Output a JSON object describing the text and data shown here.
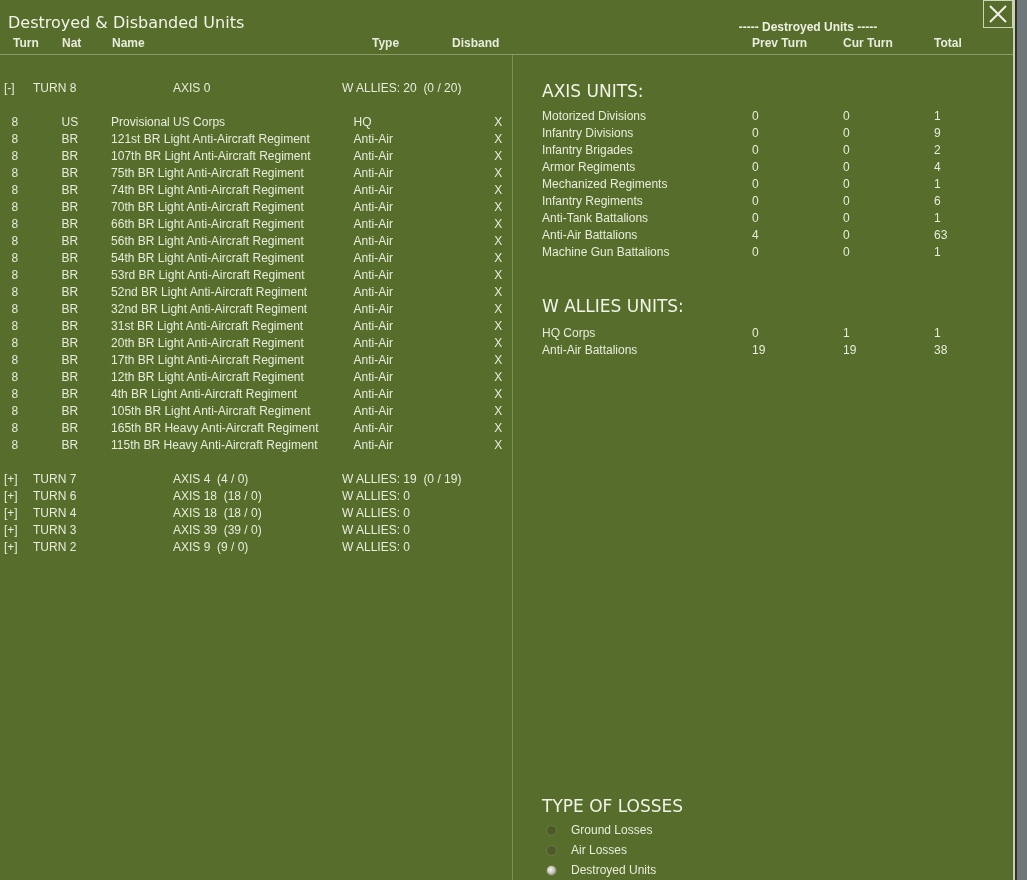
{
  "window": {
    "title": "Destroyed & Disbanded Units"
  },
  "left_columns": [
    "Turn",
    "Nat",
    "Name",
    "Type",
    "Disband"
  ],
  "right_header": {
    "group_label": "----- Destroyed Units -----",
    "columns": [
      "Prev Turn",
      "Cur Turn",
      "Total"
    ]
  },
  "turns": [
    {
      "toggle": "[-]",
      "label": "TURN 8",
      "axis": "AXIS 0",
      "allies": "W ALLIES: 20  (0 / 20)",
      "units": [
        {
          "turn": "8",
          "nat": "US",
          "name": "Provisional US Corps",
          "type": "HQ",
          "disband": "X"
        },
        {
          "turn": "8",
          "nat": "BR",
          "name": "121st BR Light Anti-Aircraft Regiment",
          "type": "Anti-Air",
          "disband": "X"
        },
        {
          "turn": "8",
          "nat": "BR",
          "name": "107th BR Light Anti-Aircraft Regiment",
          "type": "Anti-Air",
          "disband": "X"
        },
        {
          "turn": "8",
          "nat": "BR",
          "name": "75th BR Light Anti-Aircraft Regiment",
          "type": "Anti-Air",
          "disband": "X"
        },
        {
          "turn": "8",
          "nat": "BR",
          "name": "74th BR Light Anti-Aircraft Regiment",
          "type": "Anti-Air",
          "disband": "X"
        },
        {
          "turn": "8",
          "nat": "BR",
          "name": "70th BR Light Anti-Aircraft Regiment",
          "type": "Anti-Air",
          "disband": "X"
        },
        {
          "turn": "8",
          "nat": "BR",
          "name": "66th BR Light Anti-Aircraft Regiment",
          "type": "Anti-Air",
          "disband": "X"
        },
        {
          "turn": "8",
          "nat": "BR",
          "name": "56th BR Light Anti-Aircraft Regiment",
          "type": "Anti-Air",
          "disband": "X"
        },
        {
          "turn": "8",
          "nat": "BR",
          "name": "54th BR Light Anti-Aircraft Regiment",
          "type": "Anti-Air",
          "disband": "X"
        },
        {
          "turn": "8",
          "nat": "BR",
          "name": "53rd BR Light Anti-Aircraft Regiment",
          "type": "Anti-Air",
          "disband": "X"
        },
        {
          "turn": "8",
          "nat": "BR",
          "name": "52nd BR Light Anti-Aircraft Regiment",
          "type": "Anti-Air",
          "disband": "X"
        },
        {
          "turn": "8",
          "nat": "BR",
          "name": "32nd BR Light Anti-Aircraft Regiment",
          "type": "Anti-Air",
          "disband": "X"
        },
        {
          "turn": "8",
          "nat": "BR",
          "name": "31st BR Light Anti-Aircraft Regiment",
          "type": "Anti-Air",
          "disband": "X"
        },
        {
          "turn": "8",
          "nat": "BR",
          "name": "20th BR Light Anti-Aircraft Regiment",
          "type": "Anti-Air",
          "disband": "X"
        },
        {
          "turn": "8",
          "nat": "BR",
          "name": "17th BR Light Anti-Aircraft Regiment",
          "type": "Anti-Air",
          "disband": "X"
        },
        {
          "turn": "8",
          "nat": "BR",
          "name": "12th BR Light Anti-Aircraft Regiment",
          "type": "Anti-Air",
          "disband": "X"
        },
        {
          "turn": "8",
          "nat": "BR",
          "name": "4th BR Light Anti-Aircraft Regiment",
          "type": "Anti-Air",
          "disband": "X"
        },
        {
          "turn": "8",
          "nat": "BR",
          "name": "105th BR Light Anti-Aircraft Regiment",
          "type": "Anti-Air",
          "disband": "X"
        },
        {
          "turn": "8",
          "nat": "BR",
          "name": "165th BR Heavy Anti-Aircraft Regiment",
          "type": "Anti-Air",
          "disband": "X"
        },
        {
          "turn": "8",
          "nat": "BR",
          "name": "115th BR Heavy Anti-Aircraft Regiment",
          "type": "Anti-Air",
          "disband": "X"
        }
      ]
    },
    {
      "toggle": "[+]",
      "label": "TURN 7",
      "axis": "AXIS 4  (4 / 0)",
      "allies": "W ALLIES: 19  (0 / 19)"
    },
    {
      "toggle": "[+]",
      "label": "TURN 6",
      "axis": "AXIS 18  (18 / 0)",
      "allies": "W ALLIES: 0"
    },
    {
      "toggle": "[+]",
      "label": "TURN 4",
      "axis": "AXIS 18  (18 / 0)",
      "allies": "W ALLIES: 0"
    },
    {
      "toggle": "[+]",
      "label": "TURN 3",
      "axis": "AXIS 39  (39 / 0)",
      "allies": "W ALLIES: 0"
    },
    {
      "toggle": "[+]",
      "label": "TURN 2",
      "axis": "AXIS 9  (9 / 0)",
      "allies": "W ALLIES: 0"
    }
  ],
  "summary": [
    {
      "heading": "AXIS UNITS:",
      "rows": [
        {
          "category": "Motorized Divisions",
          "prev": "0",
          "cur": "0",
          "total": "1"
        },
        {
          "category": "Infantry Divisions",
          "prev": "0",
          "cur": "0",
          "total": "9"
        },
        {
          "category": "Infantry Brigades",
          "prev": "0",
          "cur": "0",
          "total": "2"
        },
        {
          "category": "Armor Regiments",
          "prev": "0",
          "cur": "0",
          "total": "4"
        },
        {
          "category": "Mechanized Regiments",
          "prev": "0",
          "cur": "0",
          "total": "1"
        },
        {
          "category": "Infantry Regiments",
          "prev": "0",
          "cur": "0",
          "total": "6"
        },
        {
          "category": "Anti-Tank Battalions",
          "prev": "0",
          "cur": "0",
          "total": "1"
        },
        {
          "category": "Anti-Air Battalions",
          "prev": "4",
          "cur": "0",
          "total": "63"
        },
        {
          "category": "Machine Gun Battalions",
          "prev": "0",
          "cur": "0",
          "total": "1"
        }
      ]
    },
    {
      "heading": "W ALLIES UNITS:",
      "rows": [
        {
          "category": "HQ Corps",
          "prev": "0",
          "cur": "1",
          "total": "1"
        },
        {
          "category": "Anti-Air Battalions",
          "prev": "19",
          "cur": "19",
          "total": "38"
        }
      ]
    }
  ],
  "losses": {
    "heading": "TYPE OF LOSSES",
    "options": [
      {
        "label": "Ground Losses",
        "selected": false
      },
      {
        "label": "Air Losses",
        "selected": false
      },
      {
        "label": "Destroyed Units",
        "selected": true
      }
    ]
  }
}
